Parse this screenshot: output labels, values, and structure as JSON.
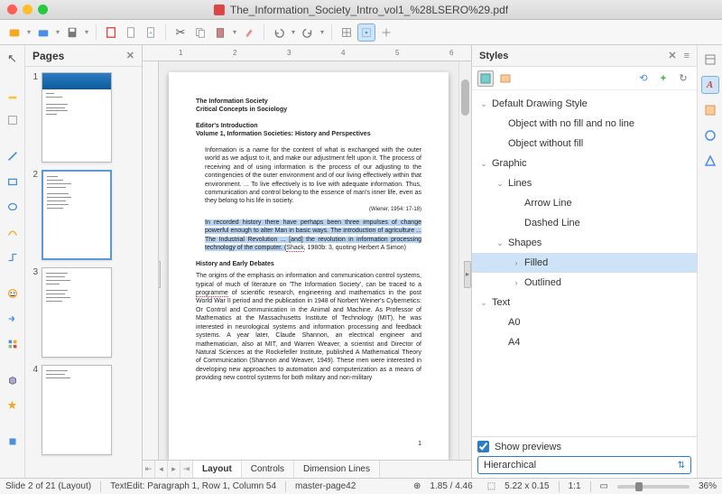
{
  "window": {
    "title": "The_Information_Society_Intro_vol1_%28LSERO%29.pdf"
  },
  "toolbar": {
    "open": "open-icon",
    "folder": "folder-icon",
    "save": "save-icon",
    "export": "export-icon",
    "file": "file-icon",
    "page": "page-icon",
    "cut": "cut-icon",
    "copy": "copy-icon",
    "paste": "paste-icon",
    "brush": "brush-icon",
    "undo": "undo-icon",
    "redo": "redo-icon",
    "grid1": "grid-icon",
    "grid2": "crosshair-icon",
    "grid3": "snap-icon"
  },
  "pages": {
    "title": "Pages",
    "items": [
      {
        "n": "1"
      },
      {
        "n": "2"
      },
      {
        "n": "3"
      },
      {
        "n": "4"
      }
    ]
  },
  "ruler": {
    "marks": [
      "1",
      "2",
      "3",
      "4",
      "5",
      "6"
    ]
  },
  "document": {
    "h1": "The Information Society",
    "h2": "Critical Concepts in Sociology",
    "h3": "Editor's Introduction",
    "h4": "Volume 1, Information Societies: History and Perspectives",
    "p1": "Information is a name for the content of what is exchanged with the outer world as we adjust to it, and make our adjustment felt upon it. The process of receiving and of using information is the process of our adjusting to the contingencies of the outer environment and of our living effectively within that environment. ... To live effectively is to live with adequate information. Thus, communication and control belong to the essence of man's inner life, even as they belong to his life in society.",
    "cite1": "(Wiener, 1954: 17-18)",
    "p2a": "In recorded history there have perhaps been three impulses of change powerful enough to alter Man in basic ways. The introduction of agriculture ... The Industrial Revolution ... [and] the revolution in information processing technology of the computer. (",
    "p2b": "Shack",
    "p2c": ", 1980b: 3, quoting Herbert A Simon)",
    "sec1": "History and Early Debates",
    "body1a": "The origins of the emphasis on information and communication control systems, typical of much of literature on 'The Information Society', can be traced to a ",
    "body1spell": "programme",
    "body1b": " of scientific research, engineering and mathematics in the post World War II period and the publication in 1948 of Norbert Weiner's Cybernetics: Or Control and Communication in the Animal and Machine. As Professor of Mathematics at the Massachusetts Institute of Technology (MIT), he was interested in neurological systems and information processing and feedback systems. A year later, Claude Shannon, an electrical engineer and mathematician, also at MIT, and Warren Weaver, a scientist and Director of Natural Sciences at the Rockefeller Institute, published A Mathematical Theory of Communication (Shannon and Weaver, 1949). These men were interested in developing new approaches to automation and computerization as a means of providing new control systems for both military and non-military",
    "pgnum": "1"
  },
  "tabs": {
    "layout": "Layout",
    "controls": "Controls",
    "dimension": "Dimension Lines"
  },
  "styles": {
    "title": "Styles",
    "tree": [
      {
        "lvl": 1,
        "caret": "v",
        "label": "Default Drawing Style"
      },
      {
        "lvl": 2,
        "caret": "",
        "label": "Object with no fill and no line"
      },
      {
        "lvl": 2,
        "caret": "",
        "label": "Object without fill"
      },
      {
        "lvl": 1,
        "caret": "v",
        "label": "Graphic"
      },
      {
        "lvl": 2,
        "caret": "v",
        "label": "Lines"
      },
      {
        "lvl": 3,
        "caret": "",
        "label": "Arrow Line"
      },
      {
        "lvl": 3,
        "caret": "",
        "label": "Dashed Line"
      },
      {
        "lvl": 2,
        "caret": "v",
        "label": "Shapes"
      },
      {
        "lvl": 3,
        "caret": ">",
        "label": "Filled",
        "sel": true
      },
      {
        "lvl": 3,
        "caret": ">",
        "label": "Outlined"
      },
      {
        "lvl": 1,
        "caret": "v",
        "label": "Text"
      },
      {
        "lvl": 2,
        "caret": "",
        "label": "A0"
      },
      {
        "lvl": 2,
        "caret": "",
        "label": "A4"
      }
    ],
    "showPreviews": "Show previews",
    "filter": "Hierarchical"
  },
  "status": {
    "slide": "Slide 2 of 21 (Layout)",
    "edit": "TextEdit: Paragraph 1, Row 1, Column 54",
    "master": "master-page42",
    "pos": "1.85 / 4.46",
    "size": "5.22 x 0.15",
    "ratio": "1:1",
    "zoom": "36%"
  }
}
